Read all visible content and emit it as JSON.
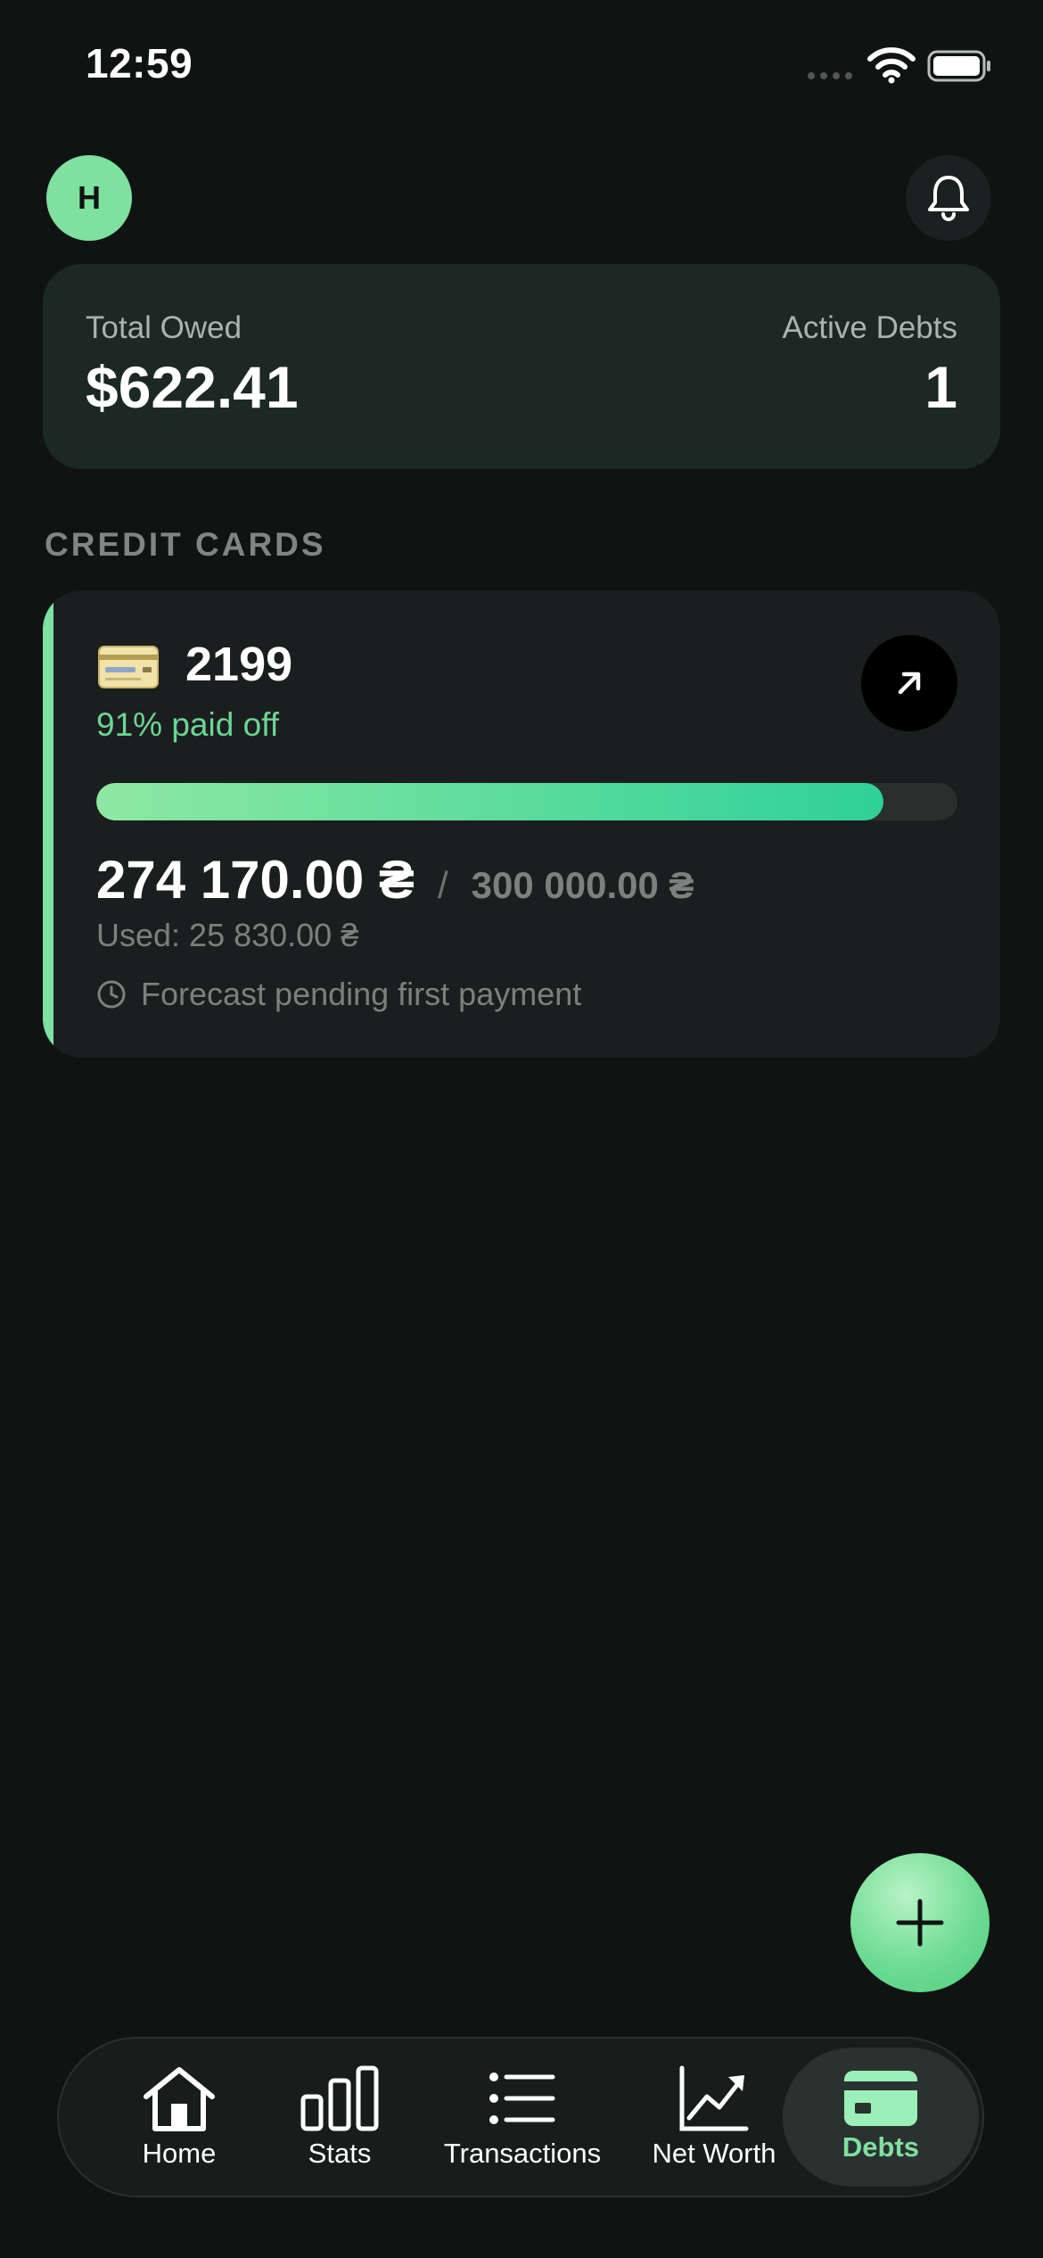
{
  "status_bar": {
    "time": "12:59"
  },
  "header": {
    "avatar_initial": "H"
  },
  "summary": {
    "total_owed_label": "Total Owed",
    "total_owed_value": "$622.41",
    "active_debts_label": "Active Debts",
    "active_debts_value": "1"
  },
  "section_title": "CREDIT CARDS",
  "credit_card": {
    "name": "2199",
    "paid_off_text": "91% paid off",
    "paid_off_fraction": 0.914,
    "available_amount": "274 170.00 ₴",
    "separator": "/",
    "limit_amount": "300 000.00 ₴",
    "used_text": "Used: 25 830.00 ₴",
    "forecast_text": "Forecast pending first payment"
  },
  "tabs": [
    {
      "label": "Home",
      "icon": "home-icon",
      "active": false
    },
    {
      "label": "Stats",
      "icon": "bar-chart-icon",
      "active": false
    },
    {
      "label": "Transactions",
      "icon": "list-icon",
      "active": false
    },
    {
      "label": "Net Worth",
      "icon": "trend-up-icon",
      "active": false
    },
    {
      "label": "Debts",
      "icon": "card-icon",
      "active": true
    }
  ],
  "colors": {
    "accent": "#7fe0a0",
    "background": "#0f1413",
    "progress_start": "#8ee8a2",
    "progress_end": "#2ed198"
  }
}
